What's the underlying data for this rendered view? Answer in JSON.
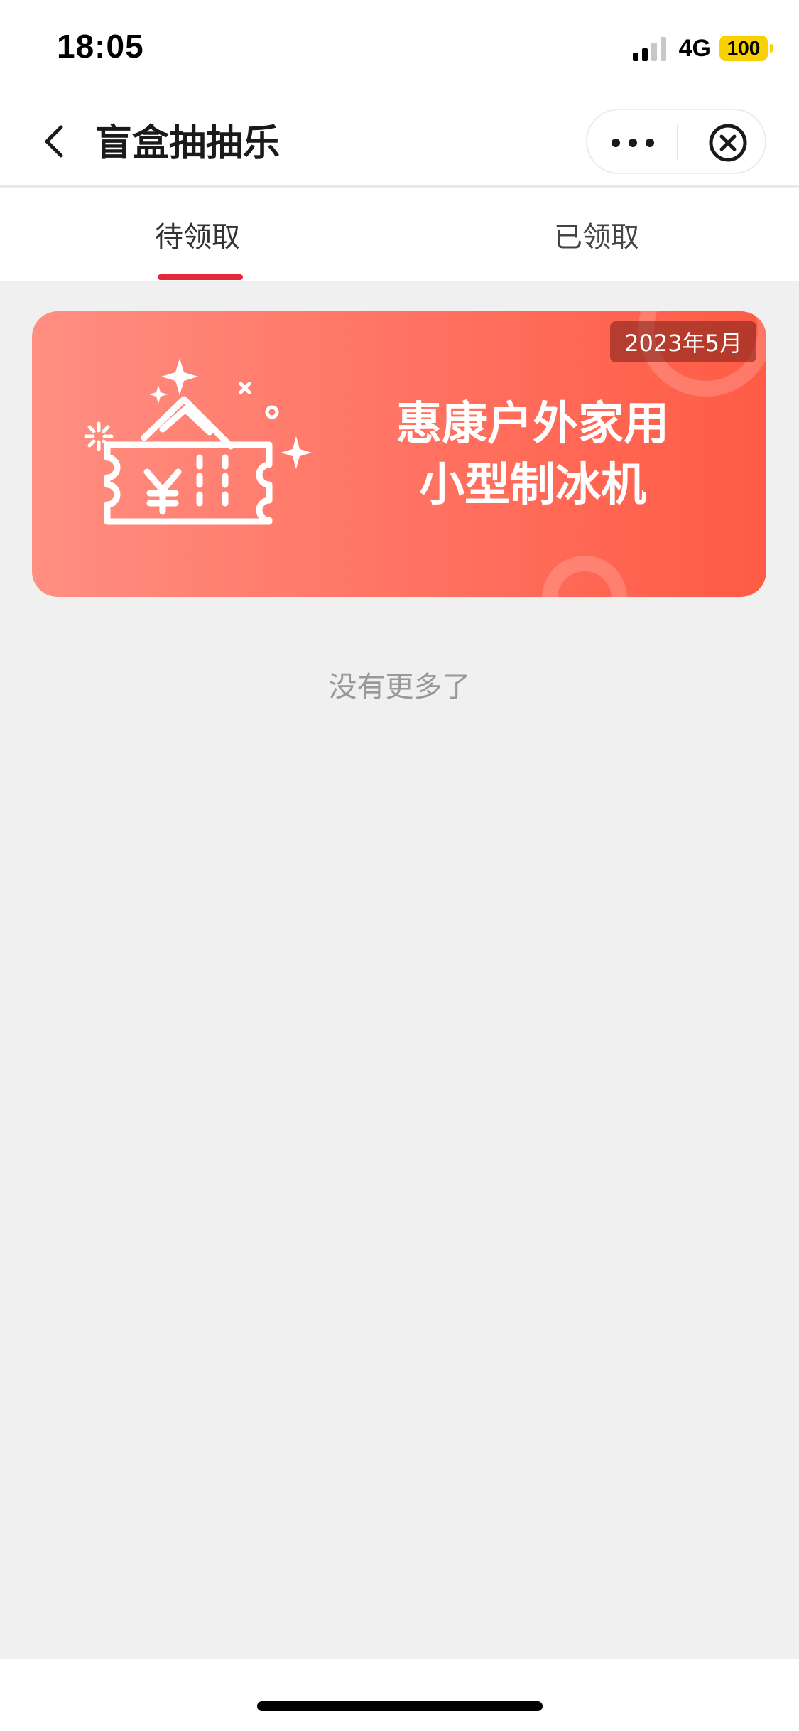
{
  "status_bar": {
    "time": "18:05",
    "network": "4G",
    "battery": "100",
    "battery_color": "#f7d100"
  },
  "nav": {
    "title": "盲盒抽抽乐",
    "back_icon": "chevron-left-icon",
    "more_icon": "more-dots-icon",
    "close_icon": "close-circle-icon"
  },
  "tabs": [
    {
      "label": "待领取",
      "active": true
    },
    {
      "label": "已领取",
      "active": false
    }
  ],
  "accent_color": "#e5283a",
  "coupon": {
    "date": "2023年5月",
    "name_line1": "惠康户外家用",
    "name_line2": "小型制冰机",
    "icon": "coupon-ticket-icon"
  },
  "list_end_text": "没有更多了"
}
